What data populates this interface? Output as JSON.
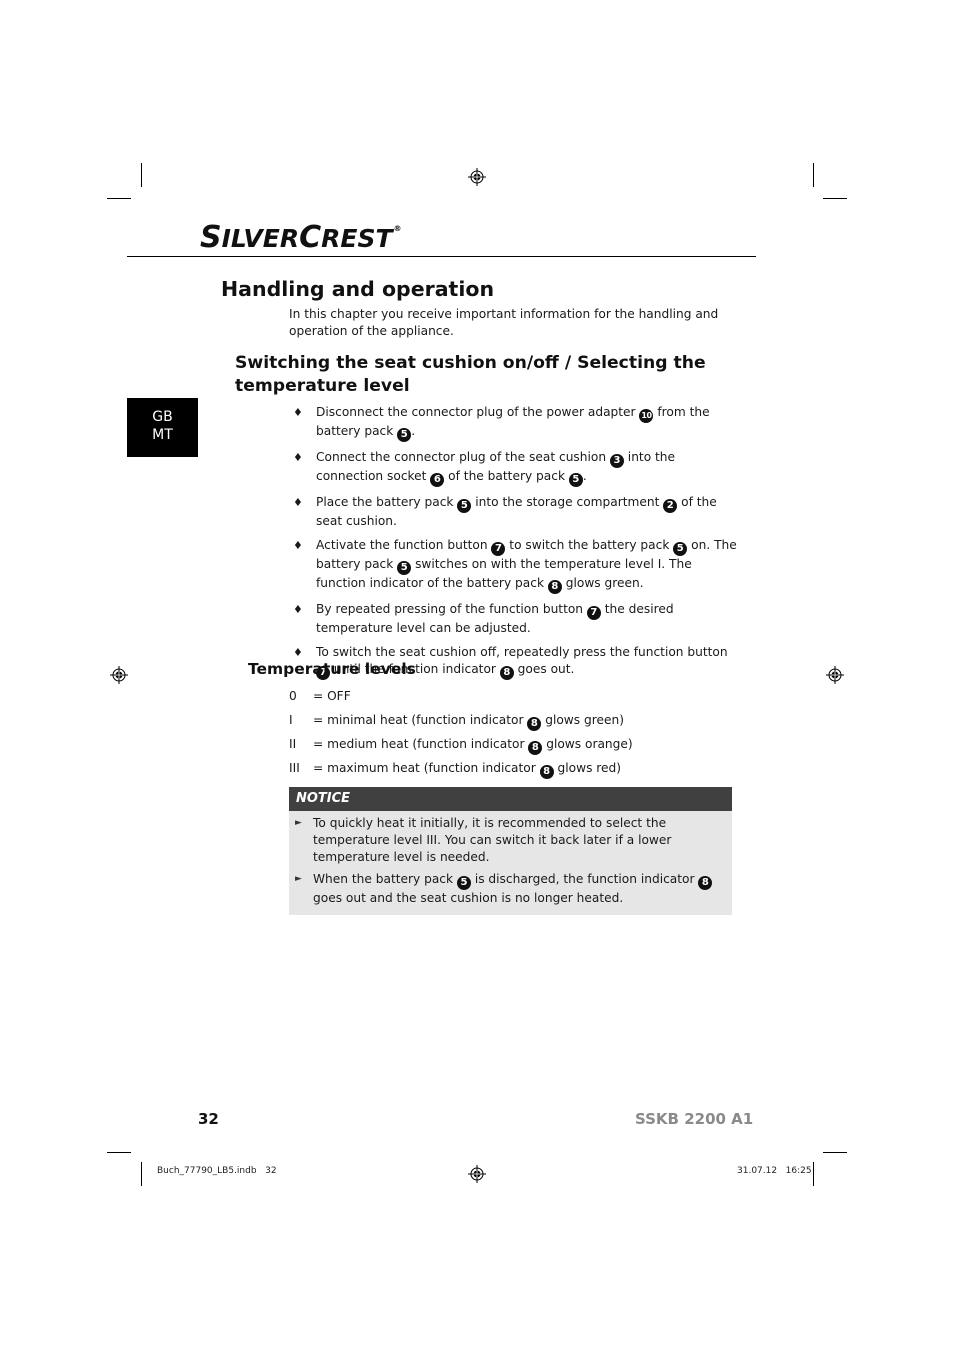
{
  "header": {
    "brand": {
      "part1_cap": "S",
      "part1_rest": "ILVER",
      "part2_cap": "C",
      "part2_rest": "REST",
      "registered": "®"
    }
  },
  "language_tab": {
    "line1": "GB",
    "line2": "MT"
  },
  "section": {
    "title": "Handling and operation",
    "intro": "In this chapter you receive important information for the handling and operation of the appliance."
  },
  "subsection": {
    "title": "Switching the seat cushion on/off / Selecting the temperature level",
    "bullet_glyph": "♦",
    "steps": [
      {
        "parts": [
          "Disconnect the connector plug of the power adapter ",
          "10",
          " from the battery pack ",
          "5",
          "."
        ]
      },
      {
        "parts": [
          "Connect the connector plug of the seat cushion ",
          "3",
          " into the connection socket ",
          "6",
          " of the battery pack ",
          "5",
          "."
        ]
      },
      {
        "parts": [
          "Place the battery pack ",
          "5",
          " into the storage compartment ",
          "2",
          " of the seat cushion."
        ]
      },
      {
        "parts": [
          "Activate the function button ",
          "7",
          " to switch the battery pack ",
          "5",
          " on. The battery pack ",
          "5",
          " switches on with the temperature level I. The function indicator of the battery pack ",
          "8",
          " glows green."
        ]
      },
      {
        "parts": [
          "By repeated pressing of the function button ",
          "7",
          " the desired temperature level can be adjusted."
        ]
      },
      {
        "parts": [
          "To switch the seat cushion off, repeatedly press the function button ",
          "7",
          " until the function indicator ",
          "8",
          " goes out."
        ]
      }
    ]
  },
  "temperature_levels": {
    "title": "Temperature levels",
    "rows": [
      {
        "level": "0",
        "text_before": "= OFF",
        "ref": "",
        "text_after": ""
      },
      {
        "level": "I",
        "text_before": "= minimal heat (function indicator ",
        "ref": "8",
        "text_after": " glows green)"
      },
      {
        "level": "II",
        "text_before": "= medium heat (function indicator ",
        "ref": "8",
        "text_after": " glows orange)"
      },
      {
        "level": "III",
        "text_before": "= maximum heat (function indicator ",
        "ref": "8",
        "text_after": " glows red)"
      }
    ]
  },
  "notice": {
    "title": "NOTICE",
    "arrow_glyph": "►",
    "items": [
      {
        "parts": [
          "To quickly heat it initially, it is recommended to select the temperature level III. You can switch it back later if a lower temperature level is needed."
        ]
      },
      {
        "parts": [
          "When the battery pack ",
          "5",
          " is discharged, the function indicator ",
          "8",
          " goes out and the seat cushion is no longer heated."
        ]
      }
    ]
  },
  "footer": {
    "page_number": "32",
    "model": "SSKB 2200 A1",
    "slug_file": "Buch_77790_LB5.indb   32",
    "slug_date": "31.07.12   16:25"
  }
}
